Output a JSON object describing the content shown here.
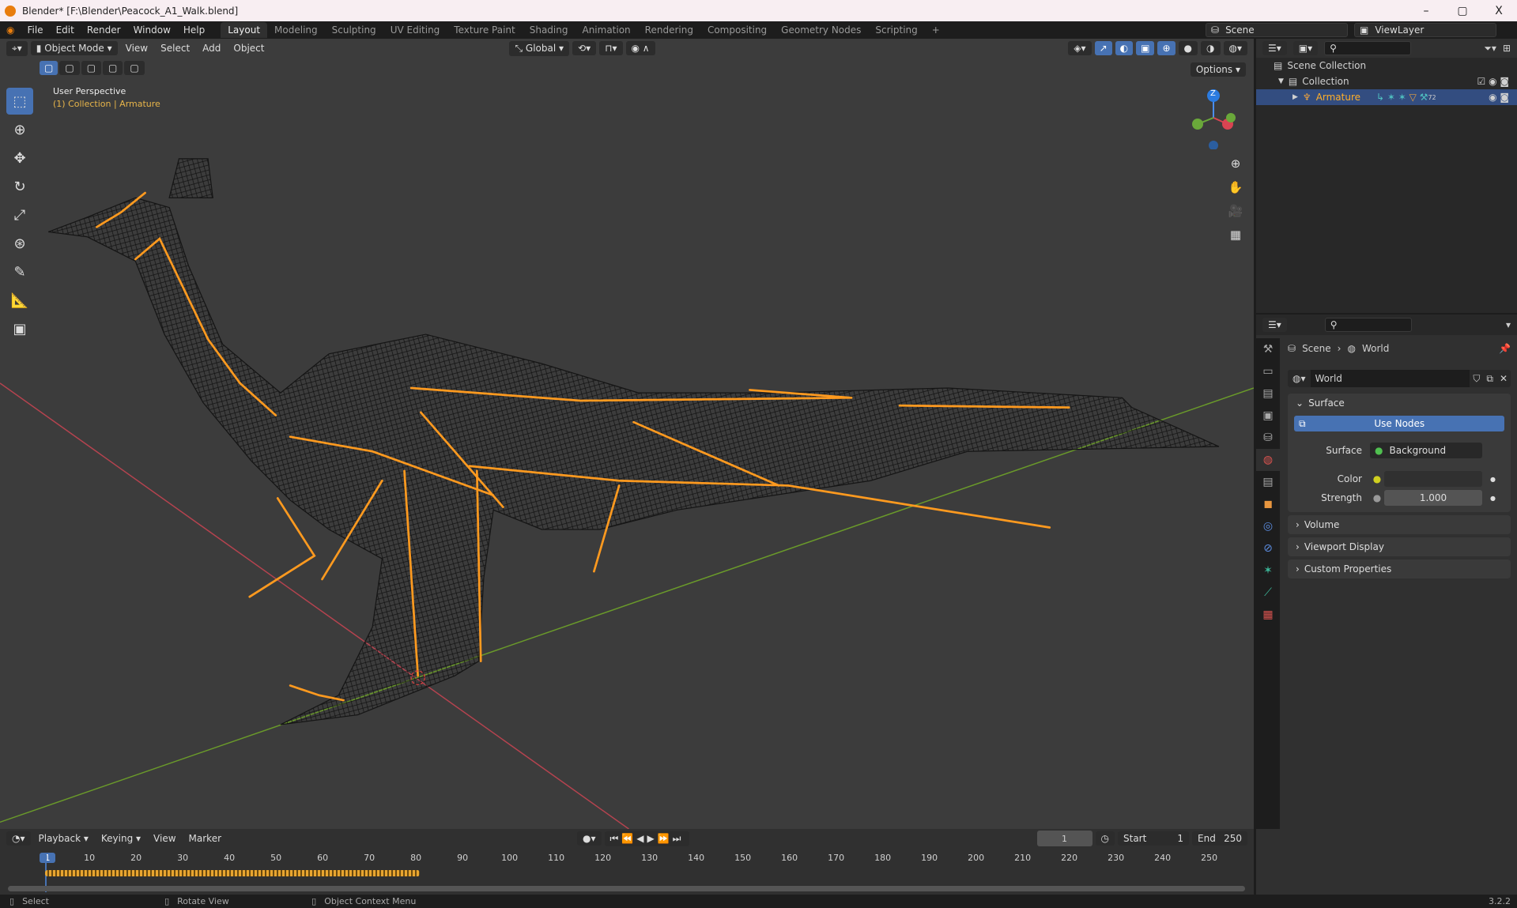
{
  "window": {
    "title": "Blender* [F:\\Blender\\Peacock_A1_Walk.blend]",
    "minimize": "–",
    "maximize": "▢",
    "close": "X"
  },
  "menu": [
    "File",
    "Edit",
    "Render",
    "Window",
    "Help"
  ],
  "workspaces": [
    "Layout",
    "Modeling",
    "Sculpting",
    "UV Editing",
    "Texture Paint",
    "Shading",
    "Animation",
    "Rendering",
    "Compositing",
    "Geometry Nodes",
    "Scripting",
    "+"
  ],
  "scene": {
    "scene_name": "Scene",
    "view_layer": "ViewLayer"
  },
  "viewport": {
    "mode": "Object Mode",
    "menus": [
      "View",
      "Select",
      "Add",
      "Object"
    ],
    "transform_orientation": "Global",
    "options_label": "Options",
    "overlay_title": "User Perspective",
    "overlay_subtitle": "(1) Collection | Armature",
    "gizmo_axis_z": "Z",
    "colors": {
      "bone": "#ff9a1f",
      "x_axis": "#b5434f",
      "y_axis": "#6a9a2a"
    }
  },
  "outliner": {
    "items": [
      {
        "label": "Scene Collection"
      },
      {
        "label": "Collection"
      },
      {
        "label": "Armature",
        "badge": "72"
      }
    ]
  },
  "properties": {
    "breadcrumb": [
      "Scene",
      "World"
    ],
    "world_name": "World",
    "surface_panel": "Surface",
    "use_nodes_label": "Use Nodes",
    "surface_label": "Surface",
    "surface_value": "Background",
    "color_label": "Color",
    "strength_label": "Strength",
    "strength_value": "1.000",
    "collapsed_panels": [
      "Volume",
      "Viewport Display",
      "Custom Properties"
    ]
  },
  "timeline": {
    "menus": [
      "Playback",
      "Keying",
      "View",
      "Marker"
    ],
    "current_frame": "1",
    "start_label": "Start",
    "start_value": "1",
    "end_label": "End",
    "end_value": "250",
    "ticks": [
      "1",
      "10",
      "20",
      "30",
      "40",
      "50",
      "60",
      "70",
      "80",
      "90",
      "100",
      "110",
      "120",
      "130",
      "140",
      "150",
      "160",
      "170",
      "180",
      "190",
      "200",
      "210",
      "220",
      "230",
      "240",
      "250"
    ]
  },
  "statusbar": {
    "items": [
      "Select",
      "Rotate View",
      "Object Context Menu"
    ],
    "version": "3.2.2"
  }
}
